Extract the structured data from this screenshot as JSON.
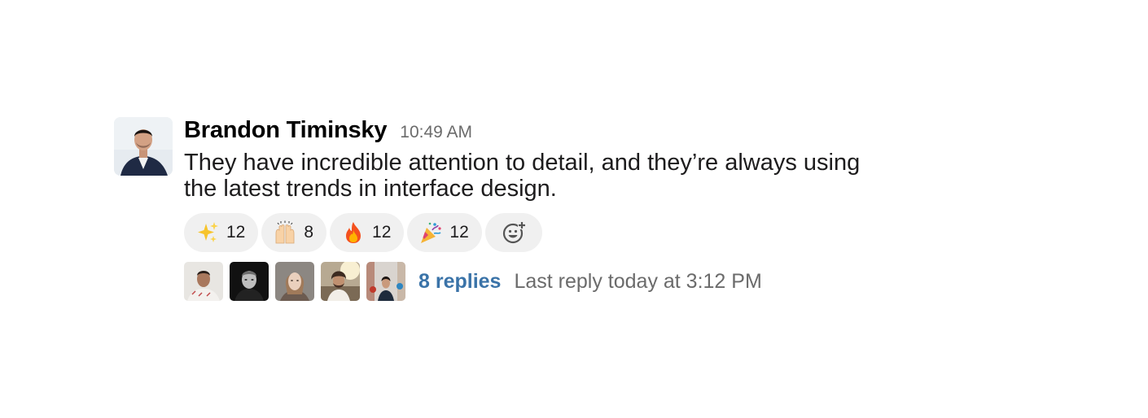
{
  "message": {
    "author": "Brandon Timinsky",
    "time": "10:49 AM",
    "text": "They have incredible attention to detail, and they’re always using the latest trends in interface design.",
    "avatar_icon": "user-photo"
  },
  "reactions": [
    {
      "emoji": "sparkles",
      "count": "12"
    },
    {
      "emoji": "raised-hands",
      "count": "8"
    },
    {
      "emoji": "fire",
      "count": "12"
    },
    {
      "emoji": "party-popper",
      "count": "12"
    }
  ],
  "add_reaction_icon": "add-reaction-icon",
  "thread": {
    "participants": [
      "participant-1",
      "participant-2",
      "participant-3",
      "participant-4",
      "participant-5"
    ],
    "replies_label": "8 replies",
    "last_reply": "Last reply today at 3:12 PM"
  },
  "colors": {
    "link": "#3a73a8",
    "muted": "#6b6b6b",
    "reaction_bg": "#f0f0f0"
  }
}
